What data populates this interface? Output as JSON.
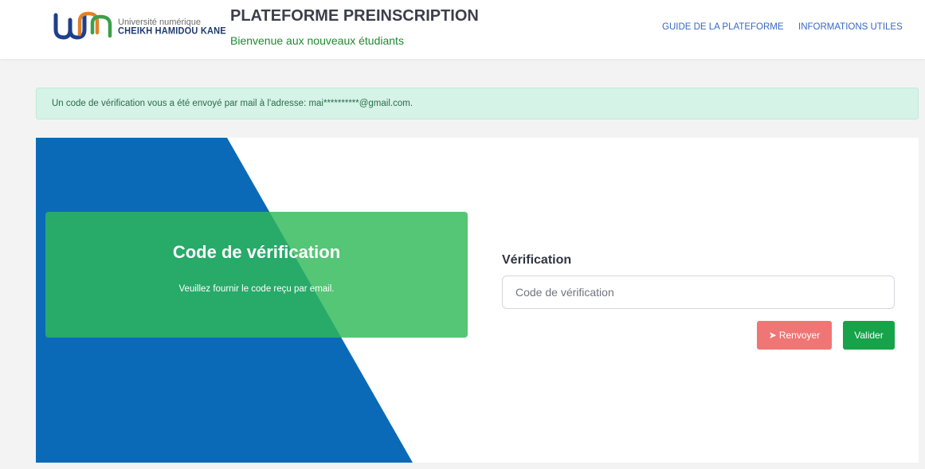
{
  "header": {
    "logo_line1": "Université numérique",
    "logo_line2": "CHEIKH HAMIDOU KANE",
    "title": "PLATEFORME PREINSCRIPTION",
    "subtitle": "Bienvenue aux nouveaux étudiants",
    "nav": [
      {
        "label": "GUIDE DE LA PLATEFORME"
      },
      {
        "label": "INFORMATIONS UTILES"
      }
    ]
  },
  "alert": {
    "text": "Un code de vérification vous a été envoyé par mail à l'adresse: mai**********@gmail.com."
  },
  "panel": {
    "title": "Code de vérification",
    "text": "Veuillez fournir le code reçu par email."
  },
  "form": {
    "label": "Vérification",
    "placeholder": "Code de vérification",
    "value": "",
    "resend_label": "Renvoyer",
    "resend_icon": "paper-plane-icon",
    "submit_label": "Valider"
  },
  "colors": {
    "brand_blue": "#0a6ab8",
    "green": "#30b858",
    "resend": "#f07675",
    "submit": "#16a34a",
    "alert_bg": "#d6f3e8"
  }
}
